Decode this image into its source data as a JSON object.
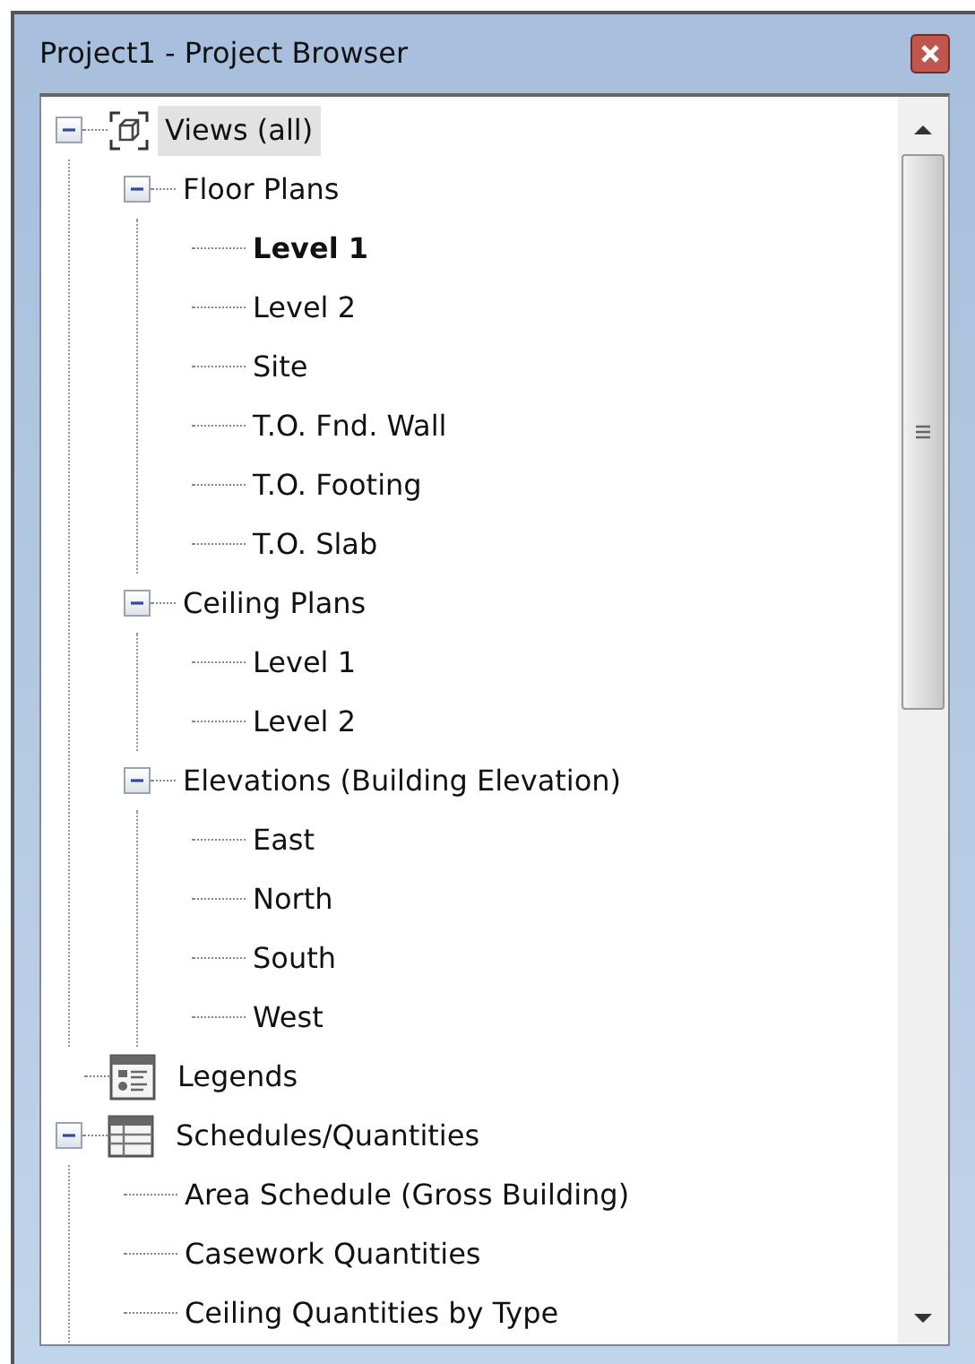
{
  "window": {
    "title": "Project1 - Project Browser"
  },
  "tree": [
    {
      "label": "Views (all)",
      "kind": "views",
      "selected": true,
      "expanded": true,
      "children": [
        {
          "label": "Floor Plans",
          "selected": false,
          "expanded": true,
          "children": [
            {
              "label": "Level 1",
              "selected": false,
              "current": true
            },
            {
              "label": "Level 2",
              "selected": false,
              "current": false
            },
            {
              "label": "Site",
              "selected": false,
              "current": false
            },
            {
              "label": "T.O. Fnd. Wall",
              "selected": false,
              "current": false
            },
            {
              "label": "T.O. Footing",
              "selected": false,
              "current": false
            },
            {
              "label": "T.O. Slab",
              "selected": false,
              "current": false
            }
          ]
        },
        {
          "label": "Ceiling Plans",
          "selected": false,
          "expanded": true,
          "children": [
            {
              "label": "Level 1",
              "selected": false,
              "current": false
            },
            {
              "label": "Level 2",
              "selected": false,
              "current": false
            }
          ]
        },
        {
          "label": "Elevations (Building Elevation)",
          "selected": false,
          "expanded": true,
          "children": [
            {
              "label": "East",
              "selected": false,
              "current": false
            },
            {
              "label": "North",
              "selected": false,
              "current": false
            },
            {
              "label": "South",
              "selected": false,
              "current": false
            },
            {
              "label": "West",
              "selected": false,
              "current": false
            }
          ]
        }
      ]
    },
    {
      "label": "Legends",
      "kind": "legend",
      "selected": false
    },
    {
      "label": "Schedules/Quantities",
      "kind": "schedule",
      "selected": false,
      "expanded": true,
      "children": [
        {
          "label": "Area Schedule (Gross Building)",
          "selected": false,
          "current": false
        },
        {
          "label": "Casework Quantities",
          "selected": false,
          "current": false
        },
        {
          "label": "Ceiling Quantities by Type",
          "selected": false,
          "current": false
        }
      ]
    }
  ]
}
